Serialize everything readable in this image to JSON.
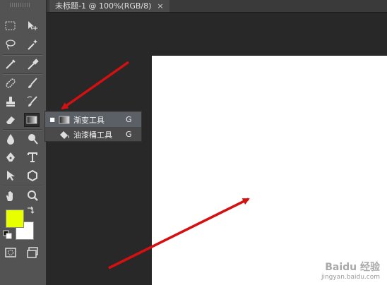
{
  "tab": {
    "title": "未标题-1 @ 100%(RGB/8)",
    "close": "×"
  },
  "tools": [
    {
      "name": "marquee-icon"
    },
    {
      "name": "move-icon"
    },
    {
      "name": "lasso-icon"
    },
    {
      "name": "magic-wand-icon"
    },
    {
      "name": "crop-icon"
    },
    {
      "name": "eyedropper-icon"
    },
    {
      "name": "healing-brush-icon"
    },
    {
      "name": "brush-icon"
    },
    {
      "name": "clone-stamp-icon"
    },
    {
      "name": "history-brush-icon"
    },
    {
      "name": "eraser-icon"
    },
    {
      "name": "gradient-icon"
    },
    {
      "name": "blur-icon"
    },
    {
      "name": "dodge-icon"
    },
    {
      "name": "pen-icon"
    },
    {
      "name": "type-icon"
    },
    {
      "name": "path-selection-icon"
    },
    {
      "name": "shape-icon"
    },
    {
      "name": "hand-icon"
    },
    {
      "name": "zoom-icon"
    }
  ],
  "colors": {
    "foreground": "#e8ff00",
    "background": "#ffffff",
    "arrow": "#d41010"
  },
  "flyout": {
    "items": [
      {
        "label": "渐变工具",
        "shortcut": "G",
        "selected": true,
        "icon": "gradient-icon"
      },
      {
        "label": "油漆桶工具",
        "shortcut": "G",
        "selected": false,
        "icon": "paint-bucket-icon"
      }
    ]
  },
  "watermark": {
    "line1": "Baidu 经验",
    "line2": "jingyan.baidu.com"
  }
}
